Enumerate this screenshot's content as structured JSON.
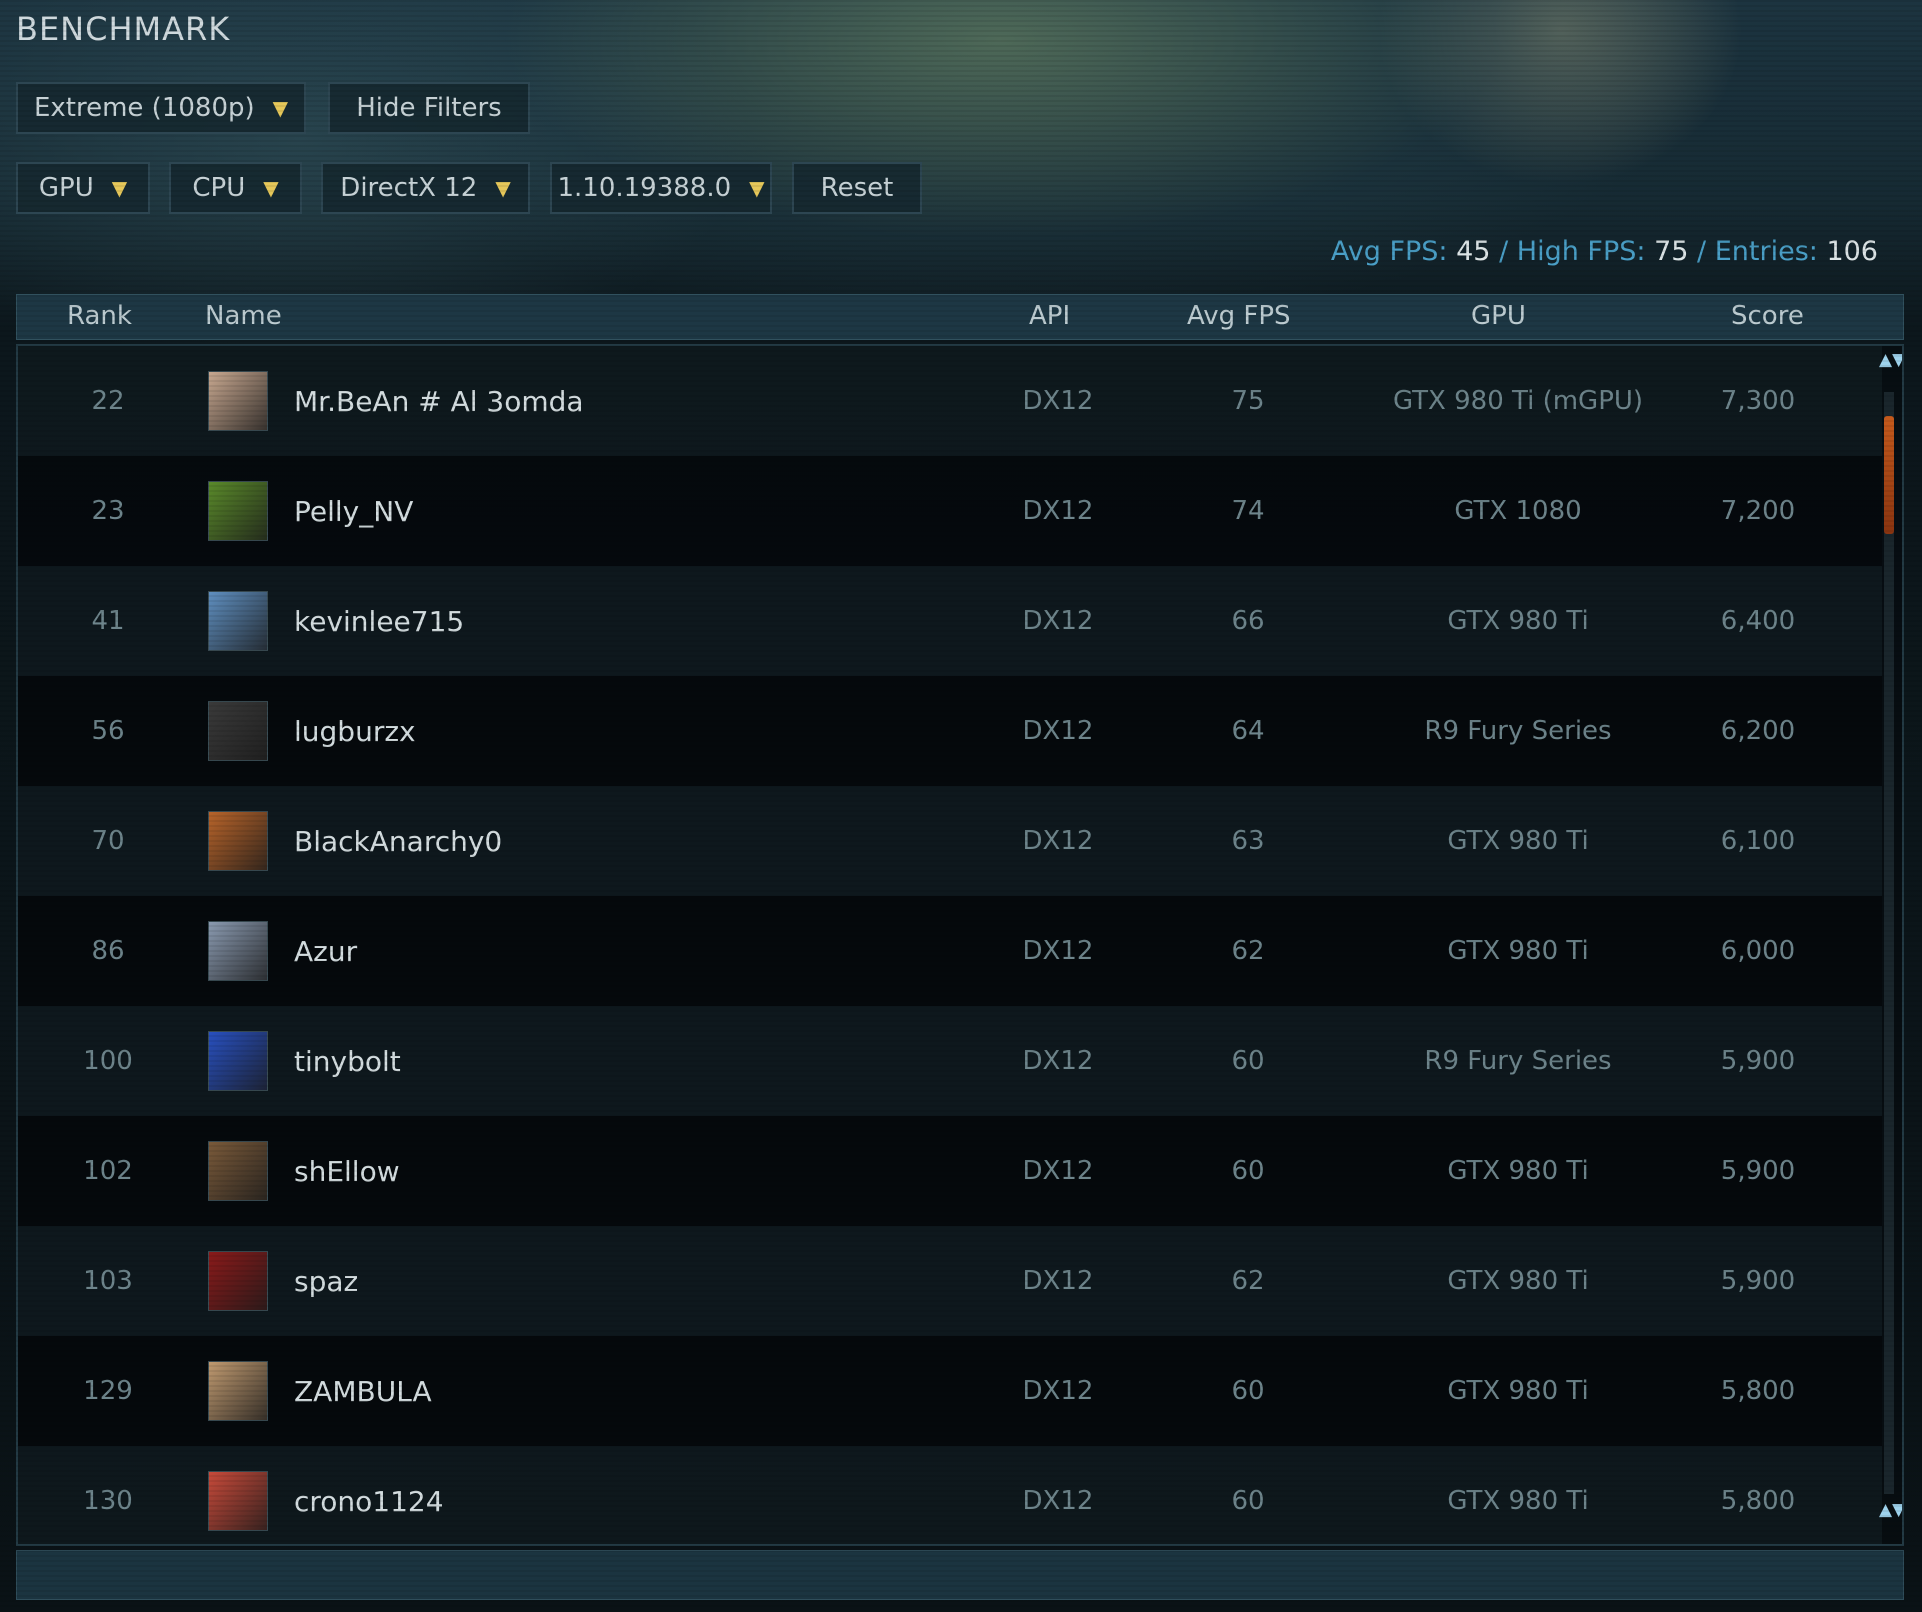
{
  "title": "BENCHMARK",
  "preset_dropdown": "Extreme (1080p)",
  "hide_filters_label": "Hide Filters",
  "filters": {
    "gpu": "GPU",
    "cpu": "CPU",
    "directx": "DirectX 12",
    "version": "1.10.19388.0",
    "reset": "Reset"
  },
  "stats": {
    "avg_label": "Avg FPS:",
    "avg_value": "45",
    "sep1": "/",
    "high_label": "High FPS:",
    "high_value": "75",
    "sep2": "/",
    "entries_label": "Entries:",
    "entries_value": "106"
  },
  "columns": {
    "rank": "Rank",
    "name": "Name",
    "api": "API",
    "avg_fps": "Avg FPS",
    "gpu": "GPU",
    "score": "Score"
  },
  "rows": [
    {
      "rank": "22",
      "name": "Mr.BeAn # Al 3omda",
      "api": "DX12",
      "avg_fps": "75",
      "gpu": "GTX 980 Ti (mGPU)",
      "score": "7,300",
      "avatar_color": "#c8a890"
    },
    {
      "rank": "23",
      "name": "Pelly_NV",
      "api": "DX12",
      "avg_fps": "74",
      "gpu": "GTX 1080",
      "score": "7,200",
      "avatar_color": "#5a8a2a"
    },
    {
      "rank": "41",
      "name": "kevinlee715",
      "api": "DX12",
      "avg_fps": "66",
      "gpu": "GTX 980 Ti",
      "score": "6,400",
      "avatar_color": "#5f8fc0"
    },
    {
      "rank": "56",
      "name": "lugburzx",
      "api": "DX12",
      "avg_fps": "64",
      "gpu": "R9 Fury Series",
      "score": "6,200",
      "avatar_color": "#3a3a3a"
    },
    {
      "rank": "70",
      "name": "BlackAnarchy0",
      "api": "DX12",
      "avg_fps": "63",
      "gpu": "GTX 980 Ti",
      "score": "6,100",
      "avatar_color": "#b8642a"
    },
    {
      "rank": "86",
      "name": "Azur",
      "api": "DX12",
      "avg_fps": "62",
      "gpu": "GTX 980 Ti",
      "score": "6,000",
      "avatar_color": "#8a9ab0"
    },
    {
      "rank": "100",
      "name": "tinybolt",
      "api": "DX12",
      "avg_fps": "60",
      "gpu": "R9 Fury Series",
      "score": "5,900",
      "avatar_color": "#2850c0"
    },
    {
      "rank": "102",
      "name": "shEllow",
      "api": "DX12",
      "avg_fps": "60",
      "gpu": "GTX 980 Ti",
      "score": "5,900",
      "avatar_color": "#7a5a3a"
    },
    {
      "rank": "103",
      "name": "spaz",
      "api": "DX12",
      "avg_fps": "62",
      "gpu": "GTX 980 Ti",
      "score": "5,900",
      "avatar_color": "#8a1a1a"
    },
    {
      "rank": "129",
      "name": "ZAMBULA",
      "api": "DX12",
      "avg_fps": "60",
      "gpu": "GTX 980 Ti",
      "score": "5,800",
      "avatar_color": "#c09a70"
    },
    {
      "rank": "130",
      "name": "crono1124",
      "api": "DX12",
      "avg_fps": "60",
      "gpu": "GTX 980 Ti",
      "score": "5,800",
      "avatar_color": "#c84a3a"
    }
  ],
  "scrollbar": {
    "up_icon": "▲▼",
    "down_icon": "▲▼",
    "position": 0.02
  }
}
